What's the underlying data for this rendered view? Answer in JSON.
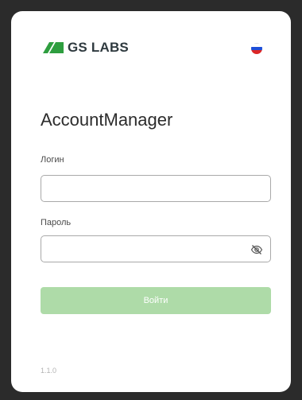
{
  "header": {
    "brand_name": "GS LABS",
    "logo_color": "#2e9e3f",
    "language_flag": "russian-flag-icon",
    "flag_colors": [
      "#ffffff",
      "#1d4ed8",
      "#dc2626"
    ]
  },
  "main": {
    "title": "AccountManager",
    "login": {
      "label": "Логин",
      "value": "",
      "placeholder": ""
    },
    "password": {
      "label": "Пароль",
      "value": "",
      "placeholder": "",
      "toggle_icon": "eye-slash-icon"
    },
    "submit_label": "Войти",
    "submit_color": "#aedba8"
  },
  "footer": {
    "version": "1.1.0"
  }
}
